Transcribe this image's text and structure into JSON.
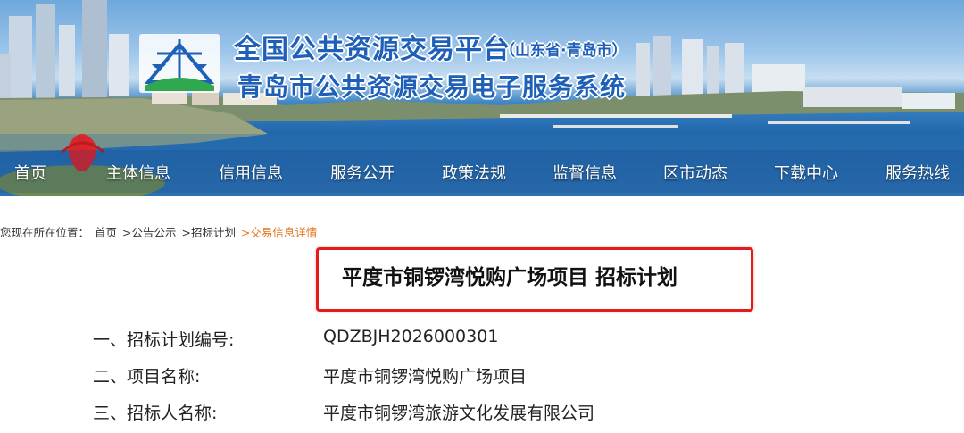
{
  "header": {
    "title_main": "全国公共资源交易平台",
    "title_region": "（山东省·青岛市）",
    "title_system": "青岛市公共资源交易电子服务系统"
  },
  "nav": {
    "items": [
      {
        "label": "首页"
      },
      {
        "label": "主体信息"
      },
      {
        "label": "信用信息"
      },
      {
        "label": "服务公开"
      },
      {
        "label": "政策法规"
      },
      {
        "label": "监督信息"
      },
      {
        "label": "区市动态"
      },
      {
        "label": "下载中心"
      },
      {
        "label": "服务热线"
      }
    ]
  },
  "breadcrumb": {
    "prefix": "您现在所在位置：",
    "items": [
      "首页",
      ">公告公示",
      ">招标计划",
      ">交易信息详情"
    ]
  },
  "notice": {
    "title": "平度市铜锣湾悦购广场项目 招标计划",
    "fields": [
      {
        "label": "一、招标计划编号:",
        "value": "QDZBJH2026000301"
      },
      {
        "label": "二、项目名称:",
        "value": "平度市铜锣湾悦购广场项目"
      },
      {
        "label": "三、招标人名称:",
        "value": "平度市铜锣湾旅游文化发展有限公司"
      }
    ]
  },
  "colors": {
    "title_blue": "#1e5fb8",
    "highlight_border": "#e21b1b",
    "breadcrumb_current": "#e3741b"
  }
}
